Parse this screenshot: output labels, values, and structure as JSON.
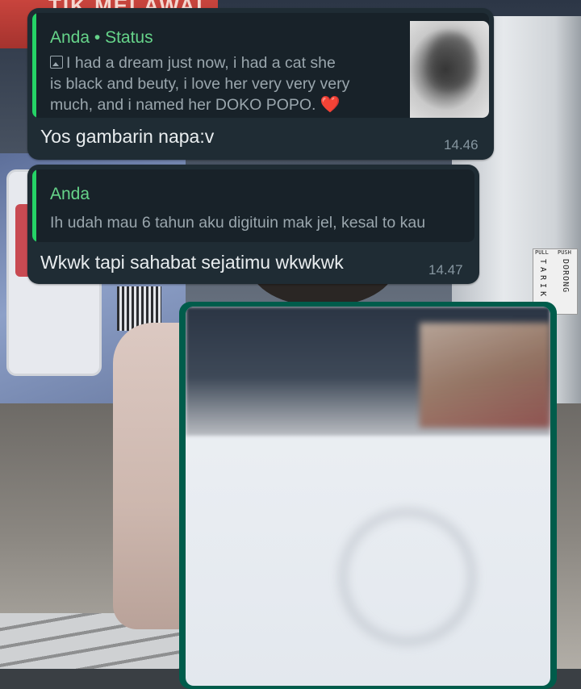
{
  "background": {
    "store_sign_text": "TIK MELAWAI",
    "door_sign": [
      "TARIK",
      "DORONG"
    ],
    "door_sign_top": [
      "PULL",
      "PUSH"
    ]
  },
  "messages": [
    {
      "quote": {
        "author": "Anda • Status",
        "text_line1": "I had a dream just now, i had a cat she",
        "text_line2": "is black and beuty, i love her very very very",
        "text_line3": "much, and i named her DOKO POPO.",
        "emoji": "❤️",
        "has_thumbnail": true
      },
      "text": "Yos gambarin napa:v",
      "time": "14.46"
    },
    {
      "quote": {
        "author": "Anda",
        "text": "Ih udah mau 6 tahun aku digituin mak jel, kesal to kau"
      },
      "text": "Wkwk tapi sahabat sejatimu wkwkwk",
      "time": "14.47"
    }
  ],
  "image_message": {
    "content": "blurred-photo"
  },
  "colors": {
    "bubble_incoming": "#1f2c34",
    "bubble_outgoing": "#005c4b",
    "quote_bar": "#25d366",
    "quote_author": "#66d48a",
    "text_primary": "#e9edef",
    "text_secondary": "#8696a0"
  }
}
